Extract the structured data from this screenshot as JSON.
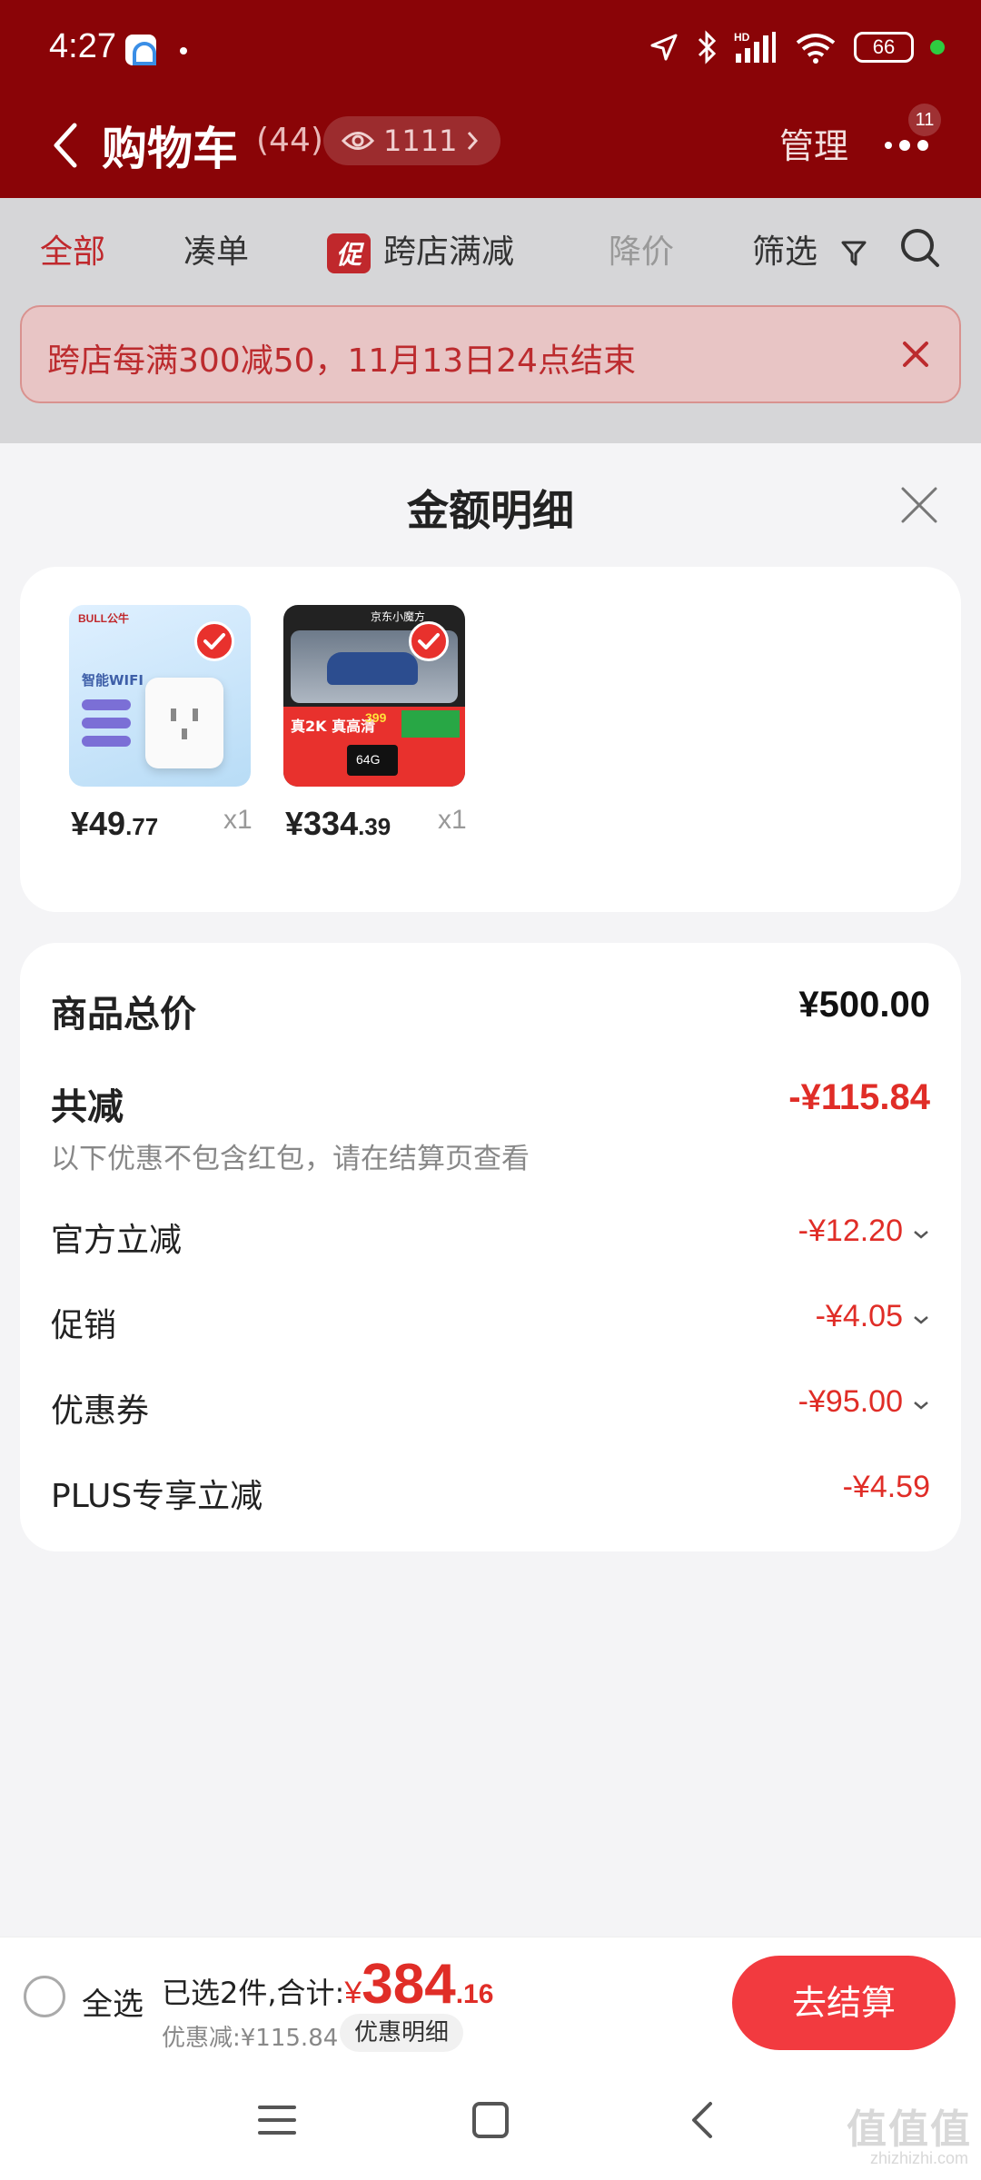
{
  "status_bar": {
    "time": "4:27",
    "battery": "66"
  },
  "header": {
    "title": "购物车",
    "count": "(44)",
    "views": "1111",
    "manage": "管理",
    "more_badge": "11"
  },
  "tabs": [
    {
      "label": "全部"
    },
    {
      "label": "凑单"
    },
    {
      "label": "跨店满减",
      "tag": "促"
    },
    {
      "label": "降价"
    },
    {
      "label": "筛选"
    }
  ],
  "banner": {
    "text": "跨店每满300减50，11月13日24点结束"
  },
  "sheet": {
    "title": "金额明细"
  },
  "products": [
    {
      "price_int": "¥49",
      "price_dec": ".77",
      "qty": "x1",
      "img_top_text": "智能WIFI",
      "img_brand": "BULL公牛"
    },
    {
      "price_int": "¥334",
      "price_dec": ".39",
      "qty": "x1",
      "img_top_text": "京东小魔方",
      "img_line1": "真2K 真高清",
      "img_line2": "64G",
      "img_price": "399"
    }
  ],
  "detail": {
    "total_label": "商品总价",
    "total_value": "¥500.00",
    "reduce_label": "共减",
    "reduce_value": "-¥115.84",
    "note": "以下优惠不包含红包，请在结算页查看",
    "items": [
      {
        "label": "官方立减",
        "value": "-¥12.20"
      },
      {
        "label": "促销",
        "value": "-¥4.05"
      },
      {
        "label": "优惠券",
        "value": "-¥95.00"
      },
      {
        "label": "PLUS专享立减",
        "value": "-¥4.59"
      }
    ]
  },
  "checkout": {
    "select_all": "全选",
    "summary_prefix": "已选2件,合计:",
    "yen": "¥",
    "total_int": "384",
    "total_dec": ".16",
    "discount": "优惠减:¥115.84",
    "discount_detail": "优惠明细",
    "button": "去结算"
  },
  "watermark": {
    "text": "值值值",
    "sub": "zhizhizhi.com"
  },
  "colors": {
    "header_bg": "#8a0407",
    "accent_red": "#e02d27",
    "checkout_button": "#f23a3f"
  }
}
